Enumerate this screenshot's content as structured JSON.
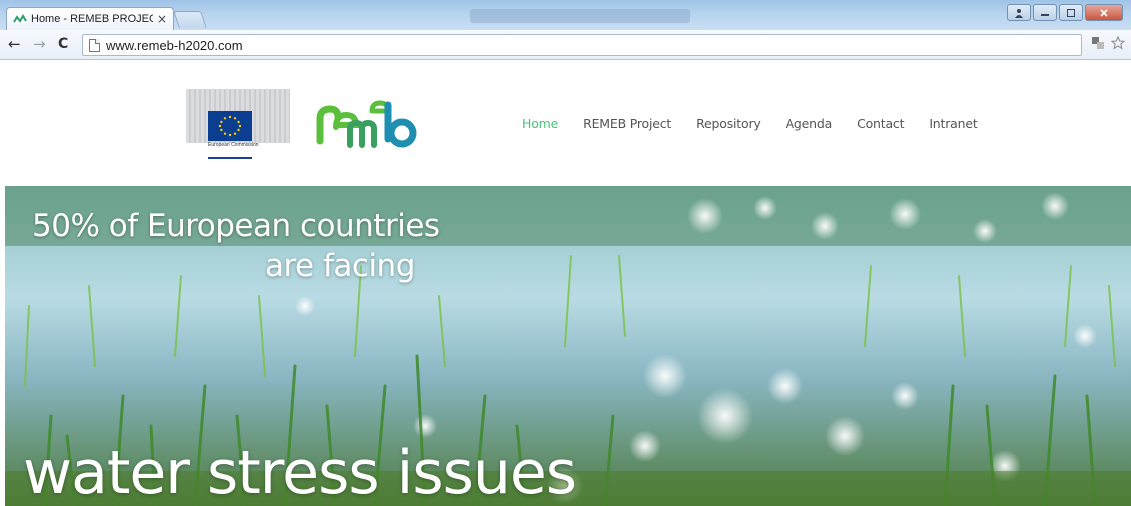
{
  "browser": {
    "tab_title": "Home - REMEB PROJECT",
    "tab_close": "×",
    "url": "www.remeb-h2020.com",
    "back_icon": "←",
    "forward_icon": "→",
    "reload_icon": "C"
  },
  "header": {
    "ec_logo_text": "European Commission",
    "nav": [
      {
        "label": "Home",
        "active": true
      },
      {
        "label": "REMEB Project",
        "active": false
      },
      {
        "label": "Repository",
        "active": false
      },
      {
        "label": "Agenda",
        "active": false
      },
      {
        "label": "Contact",
        "active": false
      },
      {
        "label": "Intranet",
        "active": false
      }
    ]
  },
  "hero": {
    "line1": "50% of European countries",
    "line2": "are facing",
    "line3": "water stress issues"
  },
  "colors": {
    "nav_active": "#46c47a",
    "logo_green": "#5cbf3c",
    "logo_teal": "#1e8fb0",
    "eu_blue": "#0b3d91"
  }
}
